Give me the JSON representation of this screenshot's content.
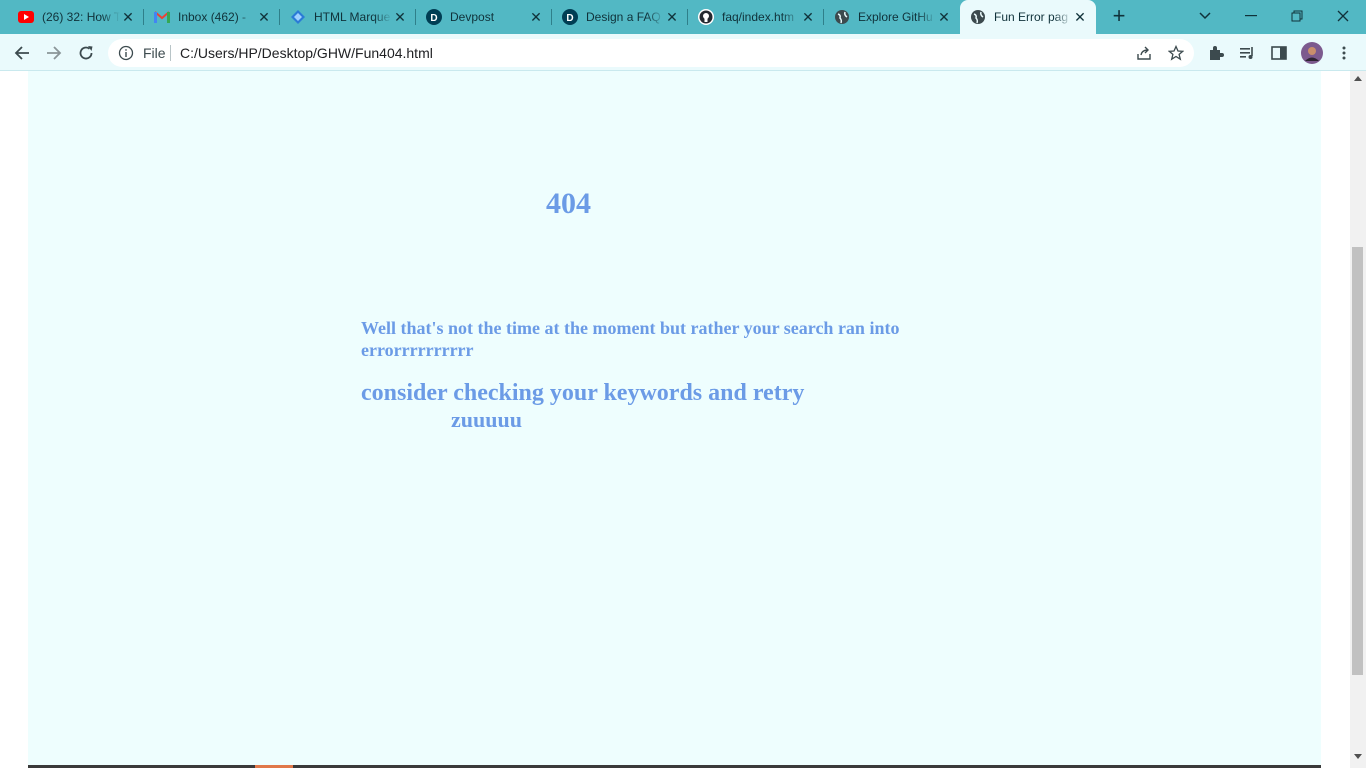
{
  "browser": {
    "tabs": [
      {
        "title": "(26) 32: How T",
        "icon": "youtube-icon",
        "close": "✕"
      },
      {
        "title": "Inbox (462) - ",
        "icon": "gmail-icon",
        "close": "✕"
      },
      {
        "title": "HTML Marque",
        "icon": "marquee-site-icon",
        "close": "✕"
      },
      {
        "title": "Devpost",
        "icon": "devpost-icon",
        "close": "✕"
      },
      {
        "title": "Design a FAQ",
        "icon": "devpost-icon",
        "close": "✕"
      },
      {
        "title": "faq/index.htm",
        "icon": "github-icon",
        "close": "✕"
      },
      {
        "title": "Explore GitHu",
        "icon": "globe-icon",
        "close": "✕"
      },
      {
        "title": "Fun Error pag",
        "icon": "globe-icon",
        "close": "✕",
        "active": true
      }
    ],
    "new_tab": "+",
    "address": {
      "scheme": "File",
      "url": "C:/Users/HP/Desktop/GHW/Fun404.html"
    }
  },
  "page": {
    "code": "404",
    "message_line1": "Well that's not the time at the moment but rather your search ran into errorrrrrrrrrr",
    "message_line2": "consider checking your keywords and retry",
    "message_line3": "zuuuuu"
  },
  "colors": {
    "tabstrip": "#52b8c4",
    "toolbar": "#eafafc",
    "page_background": "#eefefe",
    "text_accent": "#6b9be6"
  }
}
